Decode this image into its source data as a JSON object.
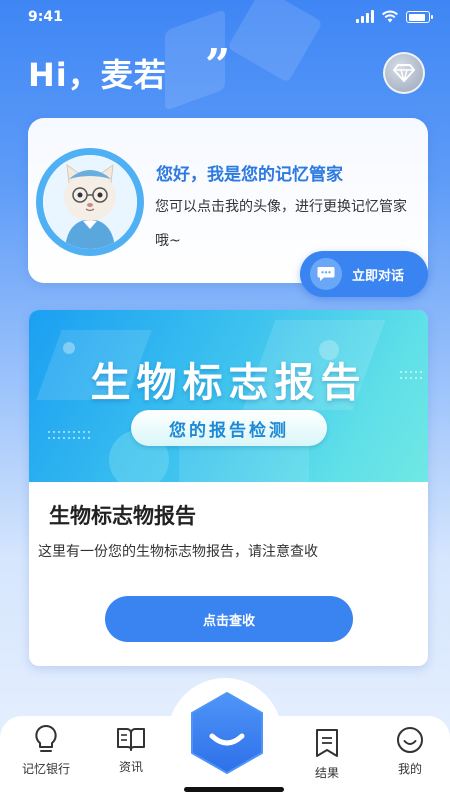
{
  "status_bar": {
    "time": "9:41"
  },
  "header": {
    "greeting": "Hi，麦若",
    "quote_mark": "”"
  },
  "assistant": {
    "title": "您好，我是您的记忆管家",
    "message": "您可以点击我的头像，进行更换记忆管家哦~",
    "talk_button": "立即对话"
  },
  "report": {
    "banner_title": "生物标志报告",
    "banner_pill": "您的报告检测",
    "title": "生物标志物报告",
    "description": "这里有一份您的生物标志物报告，请注意查收",
    "button": "点击查收"
  },
  "tabbar": {
    "items": [
      {
        "label": "记忆银行",
        "icon": "lightbulb-icon"
      },
      {
        "label": "资讯",
        "icon": "book-icon"
      },
      {
        "label": "",
        "icon": "smile-hexagon-icon"
      },
      {
        "label": "结果",
        "icon": "document-icon"
      },
      {
        "label": "我的",
        "icon": "smiley-face-icon"
      }
    ]
  },
  "colors": {
    "primary": "#3a84f2",
    "accent_text": "#2d7be0",
    "banner_start": "#1b9ff2",
    "banner_end": "#70e8e4"
  }
}
